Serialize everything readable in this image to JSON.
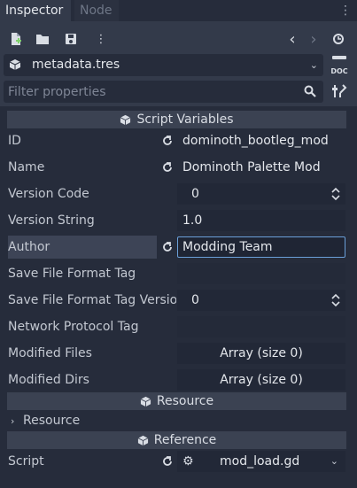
{
  "tabs": [
    {
      "label": "Inspector",
      "active": true
    },
    {
      "label": "Node",
      "active": false
    }
  ],
  "tab_menu_icon": "kebab-vertical-icon",
  "toolbar": {
    "icons": [
      "new-resource-icon",
      "open-folder-icon",
      "save-icon",
      "kebab-vertical-icon"
    ],
    "history_back": "‹",
    "history_forward": "›",
    "history_icon": "history-icon"
  },
  "resource": {
    "name": "metadata.tres",
    "doc_label": "DOC"
  },
  "filter": {
    "placeholder": "Filter properties"
  },
  "sections": {
    "script_variables": "Script Variables",
    "resource": "Resource",
    "reference": "Reference"
  },
  "props": {
    "id": {
      "label": "ID",
      "value": "dominoth_bootleg_mod"
    },
    "name": {
      "label": "Name",
      "value": "Dominoth Palette Mod"
    },
    "version_code": {
      "label": "Version Code",
      "value": "0"
    },
    "version_string": {
      "label": "Version String",
      "value": "1.0"
    },
    "author": {
      "label": "Author",
      "value": "Modding Team"
    },
    "save_file_format_tag": {
      "label": "Save File Format Tag",
      "value": ""
    },
    "save_file_format_tag_version": {
      "label": "Save File Format Tag Versio",
      "value": "0"
    },
    "network_protocol_tag": {
      "label": "Network Protocol Tag",
      "value": ""
    },
    "modified_files": {
      "label": "Modified Files",
      "value": "Array (size 0)"
    },
    "modified_dirs": {
      "label": "Modified Dirs",
      "value": "Array (size 0)"
    }
  },
  "resource_subgroup": "Resource",
  "script": {
    "label": "Script",
    "value": "mod_load.gd"
  },
  "colors": {
    "background": "#333a4a",
    "panel": "#262c3b",
    "section_header": "#3b4252",
    "focus_border": "#6a9fd8"
  }
}
